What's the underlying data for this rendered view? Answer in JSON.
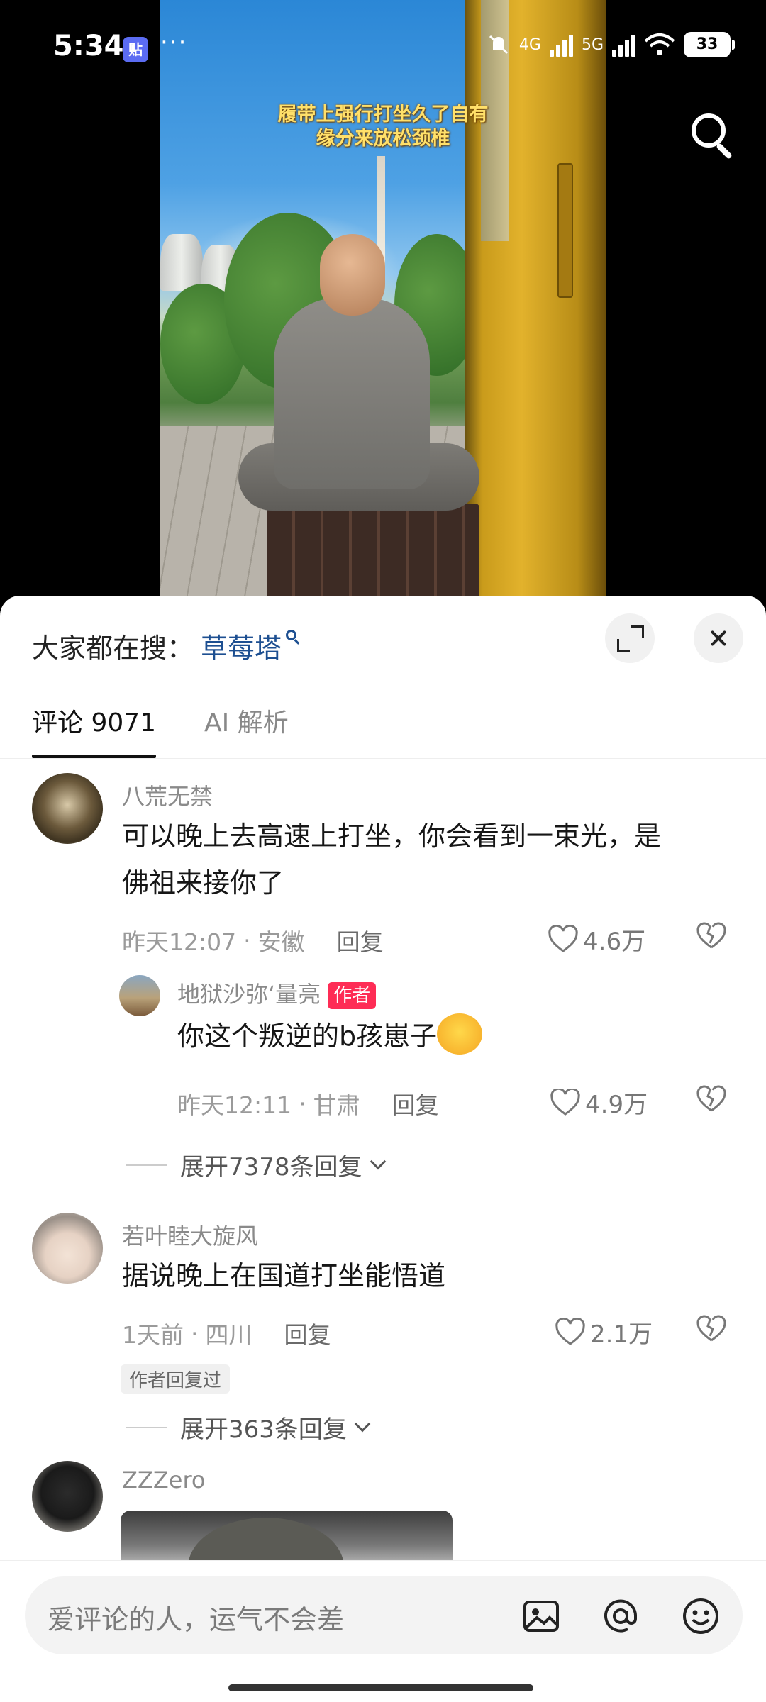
{
  "status_bar": {
    "time": "5:34",
    "notification_badge": "贴",
    "more": "···",
    "net_4g": "4G",
    "net_5g": "5G",
    "battery": "33"
  },
  "video": {
    "caption_line1": "履带上强行打坐久了自有",
    "caption_line2": "缘分来放松颈椎"
  },
  "sheet": {
    "search_label": "大家都在搜：",
    "search_term": "草莓塔",
    "tabs": [
      {
        "label": "评论 9071",
        "active": true
      },
      {
        "label": "AI 解析",
        "active": false
      }
    ]
  },
  "comments": [
    {
      "user": "八荒无禁",
      "text_line1": "可以晚上去高速上打坐，你会看到一束光，是",
      "text_line2": "佛祖来接你了",
      "time": "昨天12:07",
      "location": "安徽",
      "reply_label": "回复",
      "likes": "4.6万",
      "replies": [
        {
          "user": "地狱沙弥‘量亮",
          "author_tag": "作者",
          "text": "你这个叛逆的b孩崽子",
          "time": "昨天12:11",
          "location": "甘肃",
          "reply_label": "回复",
          "likes": "4.9万"
        }
      ],
      "expand_label": "展开7378条回复"
    },
    {
      "user": "若叶睦大旋风",
      "text_line1": "据说晚上在国道打坐能悟道",
      "time": "1天前",
      "location": "四川",
      "reply_label": "回复",
      "likes": "2.1万",
      "author_replied": "作者回复过",
      "expand_label": "展开363条回复"
    },
    {
      "user": "ZZZero"
    }
  ],
  "input_bar": {
    "placeholder": "爱评论的人，运气不会差",
    "icons": [
      "image-icon",
      "at-icon",
      "emoji-icon"
    ]
  },
  "colors": {
    "accent_link": "#1d4f91",
    "author_tag": "#fe2c55",
    "caption": "#ffe06a"
  }
}
